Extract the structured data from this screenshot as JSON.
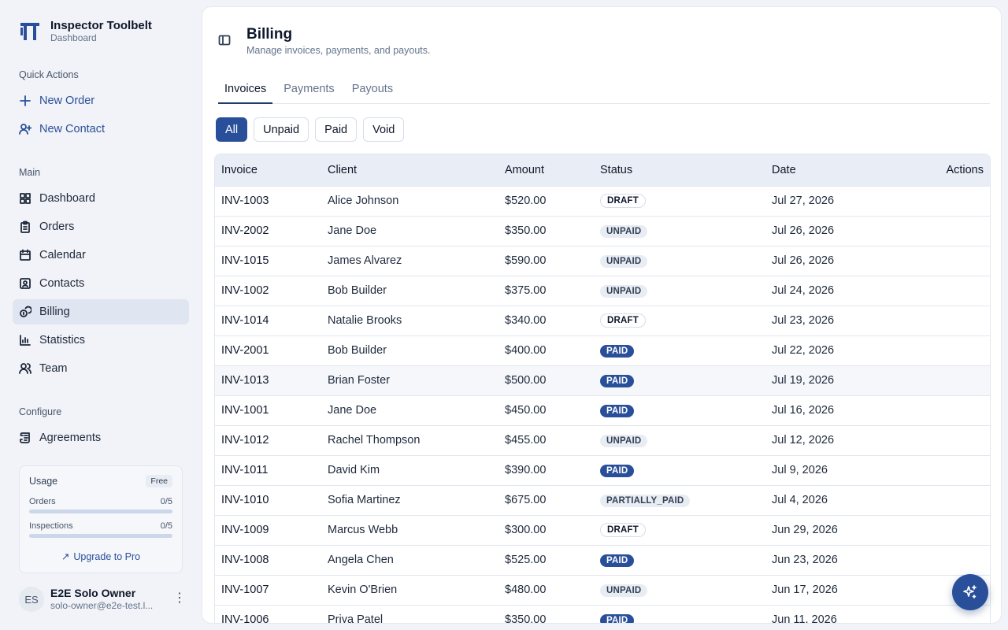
{
  "brand": {
    "title": "Inspector Toolbelt",
    "subtitle": "Dashboard"
  },
  "sidebar": {
    "quick_actions_label": "Quick Actions",
    "quick_actions": [
      {
        "label": "New Order",
        "icon": "plus-icon"
      },
      {
        "label": "New Contact",
        "icon": "user-plus-icon"
      }
    ],
    "main_label": "Main",
    "main_items": [
      {
        "label": "Dashboard",
        "icon": "dashboard-icon"
      },
      {
        "label": "Orders",
        "icon": "clipboard-icon"
      },
      {
        "label": "Calendar",
        "icon": "calendar-icon"
      },
      {
        "label": "Contacts",
        "icon": "contact-card-icon"
      },
      {
        "label": "Billing",
        "icon": "coins-icon",
        "active": true
      },
      {
        "label": "Statistics",
        "icon": "bar-chart-icon"
      },
      {
        "label": "Team",
        "icon": "users-icon"
      }
    ],
    "configure_label": "Configure",
    "configure_items": [
      {
        "label": "Agreements",
        "icon": "scroll-icon"
      }
    ]
  },
  "usage": {
    "title": "Usage",
    "plan": "Free",
    "orders_label": "Orders",
    "orders_value": "0/5",
    "orders_fraction": 0,
    "inspections_label": "Inspections",
    "inspections_value": "0/5",
    "inspections_fraction": 0,
    "upgrade_label": "Upgrade to Pro"
  },
  "user": {
    "initials": "ES",
    "name": "E2E Solo Owner",
    "email": "solo-owner@e2e-test.l..."
  },
  "page": {
    "title": "Billing",
    "subtitle": "Manage invoices, payments, and payouts."
  },
  "tabs": [
    "Invoices",
    "Payments",
    "Payouts"
  ],
  "filters": [
    "All",
    "Unpaid",
    "Paid",
    "Void"
  ],
  "table": {
    "headers": {
      "invoice": "Invoice",
      "client": "Client",
      "amount": "Amount",
      "status": "Status",
      "date": "Date",
      "actions": "Actions"
    },
    "rows": [
      {
        "invoice": "INV-1003",
        "client": "Alice Johnson",
        "amount": "$520.00",
        "status": "DRAFT",
        "date": "Jul 27, 2026"
      },
      {
        "invoice": "INV-2002",
        "client": "Jane Doe",
        "amount": "$350.00",
        "status": "UNPAID",
        "date": "Jul 26, 2026"
      },
      {
        "invoice": "INV-1015",
        "client": "James Alvarez",
        "amount": "$590.00",
        "status": "UNPAID",
        "date": "Jul 26, 2026"
      },
      {
        "invoice": "INV-1002",
        "client": "Bob Builder",
        "amount": "$375.00",
        "status": "UNPAID",
        "date": "Jul 24, 2026"
      },
      {
        "invoice": "INV-1014",
        "client": "Natalie Brooks",
        "amount": "$340.00",
        "status": "DRAFT",
        "date": "Jul 23, 2026"
      },
      {
        "invoice": "INV-2001",
        "client": "Bob Builder",
        "amount": "$400.00",
        "status": "PAID",
        "date": "Jul 22, 2026"
      },
      {
        "invoice": "INV-1013",
        "client": "Brian Foster",
        "amount": "$500.00",
        "status": "PAID",
        "date": "Jul 19, 2026"
      },
      {
        "invoice": "INV-1001",
        "client": "Jane Doe",
        "amount": "$450.00",
        "status": "PAID",
        "date": "Jul 16, 2026"
      },
      {
        "invoice": "INV-1012",
        "client": "Rachel Thompson",
        "amount": "$455.00",
        "status": "UNPAID",
        "date": "Jul 12, 2026"
      },
      {
        "invoice": "INV-1011",
        "client": "David Kim",
        "amount": "$390.00",
        "status": "PAID",
        "date": "Jul 9, 2026"
      },
      {
        "invoice": "INV-1010",
        "client": "Sofia Martinez",
        "amount": "$675.00",
        "status": "PARTIALLY_PAID",
        "date": "Jul 4, 2026"
      },
      {
        "invoice": "INV-1009",
        "client": "Marcus Webb",
        "amount": "$300.00",
        "status": "DRAFT",
        "date": "Jun 29, 2026"
      },
      {
        "invoice": "INV-1008",
        "client": "Angela Chen",
        "amount": "$525.00",
        "status": "PAID",
        "date": "Jun 23, 2026"
      },
      {
        "invoice": "INV-1007",
        "client": "Kevin O'Brien",
        "amount": "$480.00",
        "status": "UNPAID",
        "date": "Jun 17, 2026"
      },
      {
        "invoice": "INV-1006",
        "client": "Priya Patel",
        "amount": "$350.00",
        "status": "PAID",
        "date": "Jun 11, 2026"
      }
    ]
  },
  "colors": {
    "accent": "#2a4f9a",
    "active_nav": "#dfe5f1",
    "header_row": "#e9edf5"
  }
}
